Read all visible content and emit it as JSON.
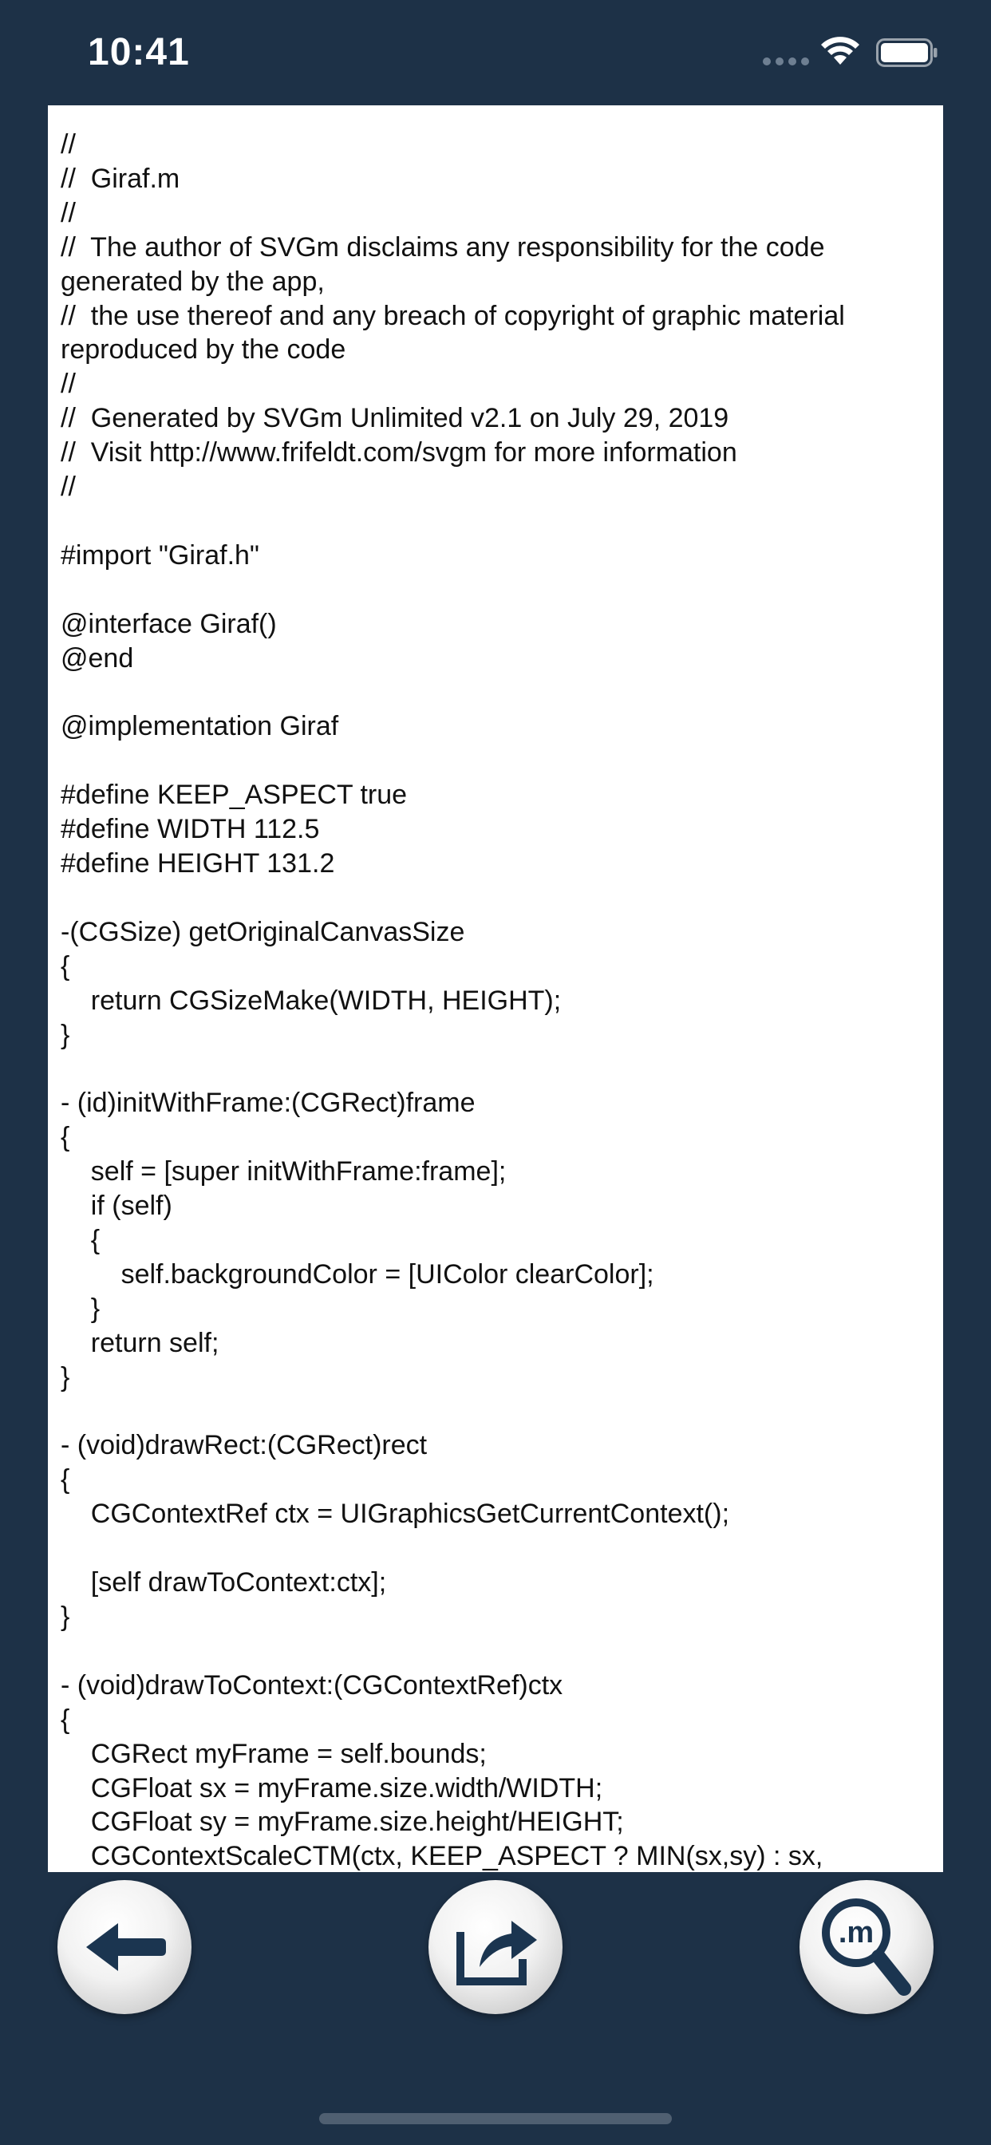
{
  "status_bar": {
    "time": "10:41"
  },
  "code_view": {
    "lines": [
      "//",
      "//  Giraf.m",
      "//",
      "//  The author of SVGm disclaims any responsibility for the code generated by the app,",
      "//  the use thereof and any breach of copyright of graphic material reproduced by the code",
      "//",
      "//  Generated by SVGm Unlimited v2.1 on July 29, 2019",
      "//  Visit http://www.frifeldt.com/svgm for more information",
      "//",
      "",
      "#import \"Giraf.h\"",
      "",
      "@interface Giraf()",
      "@end",
      "",
      "@implementation Giraf",
      "",
      "#define KEEP_ASPECT true",
      "#define WIDTH 112.5",
      "#define HEIGHT 131.2",
      "",
      "-(CGSize) getOriginalCanvasSize",
      "{",
      "    return CGSizeMake(WIDTH, HEIGHT);",
      "}",
      "",
      "- (id)initWithFrame:(CGRect)frame",
      "{",
      "    self = [super initWithFrame:frame];",
      "    if (self)",
      "    {",
      "        self.backgroundColor = [UIColor clearColor];",
      "    }",
      "    return self;",
      "}",
      "",
      "- (void)drawRect:(CGRect)rect",
      "{",
      "    CGContextRef ctx = UIGraphicsGetCurrentContext();",
      "",
      "    [self drawToContext:ctx];",
      "}",
      "",
      "- (void)drawToContext:(CGContextRef)ctx",
      "{",
      "    CGRect myFrame = self.bounds;",
      "    CGFloat sx = myFrame.size.width/WIDTH;",
      "    CGFloat sy = myFrame.size.height/HEIGHT;",
      "    CGContextScaleCTM(ctx, KEEP_ASPECT ? MIN(sx,sy) : sx,"
    ]
  },
  "toolbar": {
    "back_icon": "arrow-left-icon",
    "share_icon": "share-icon",
    "search_icon": "search-m-icon",
    "search_icon_label": ".m"
  },
  "colors": {
    "background": "#1d3147",
    "panel": "#ffffff",
    "text": "#111111",
    "button_icon": "#1b3550"
  }
}
